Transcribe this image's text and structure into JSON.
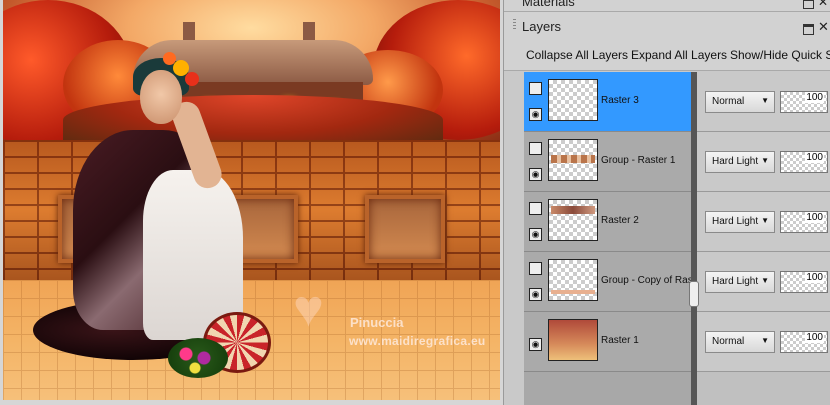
{
  "watermark": {
    "name": "Pinuccia",
    "url": "www.maidiregrafica.eu"
  },
  "panel": {
    "materials_title": "Materials",
    "layers_title": "Layers",
    "toolbar": [
      "Collapse All Layers",
      "Expand All Layers",
      "Show/Hide Quick Se"
    ],
    "layers": [
      {
        "name": "Raster 3",
        "blend": "Normal",
        "opacity": "100",
        "selected": true
      },
      {
        "name": "Group - Raster 1",
        "blend": "Hard Light",
        "opacity": "100",
        "selected": false
      },
      {
        "name": "Raster 2",
        "blend": "Hard Light",
        "opacity": "100",
        "selected": false
      },
      {
        "name": "Group - Copy of Raster",
        "blend": "Hard Light",
        "opacity": "100",
        "selected": false
      },
      {
        "name": "Raster 1",
        "blend": "Normal",
        "opacity": "100",
        "selected": false
      }
    ]
  },
  "icons": {
    "expand": "layer-group-icon",
    "visibility": "eye-icon",
    "maximize": "maximize-icon",
    "close": "close-icon",
    "dropdown": "chevron-down-icon"
  },
  "colors": {
    "selected_row": "#3399ff",
    "panel_bg": "#c9c9c9",
    "divider": "#565656"
  }
}
